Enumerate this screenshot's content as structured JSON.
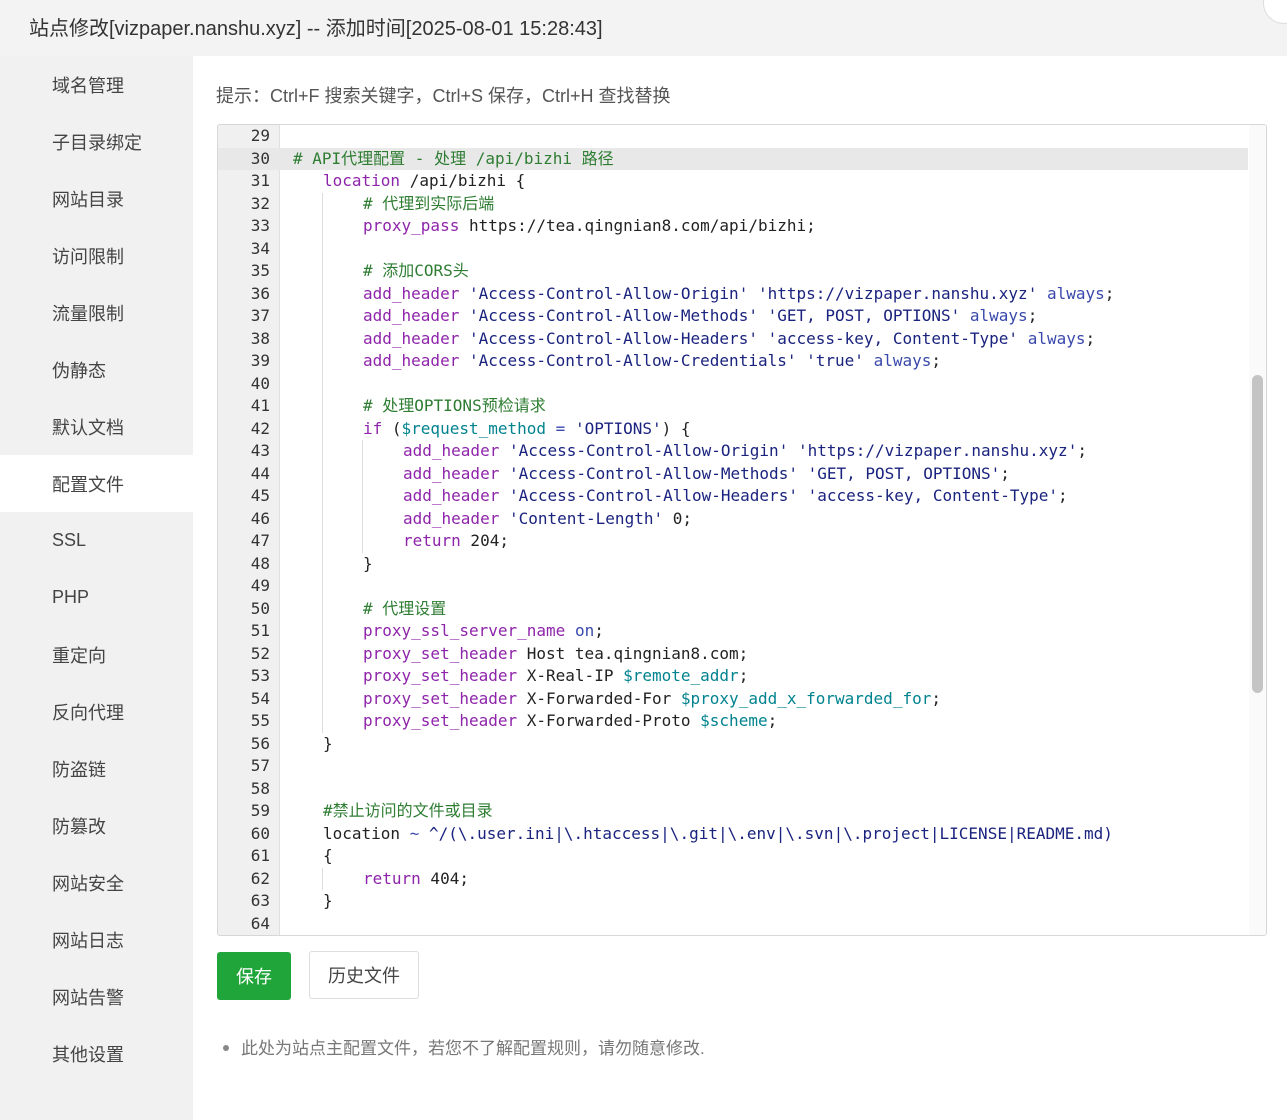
{
  "window": {
    "title": "站点修改[vizpaper.nanshu.xyz] -- 添加时间[2025-08-01 15:28:43]"
  },
  "sidebar": {
    "active_index": 7,
    "items": [
      {
        "label": "域名管理",
        "key": "domain"
      },
      {
        "label": "子目录绑定",
        "key": "subdir"
      },
      {
        "label": "网站目录",
        "key": "site-dir"
      },
      {
        "label": "访问限制",
        "key": "access-limit"
      },
      {
        "label": "流量限制",
        "key": "traffic-limit"
      },
      {
        "label": "伪静态",
        "key": "rewrite"
      },
      {
        "label": "默认文档",
        "key": "default-doc"
      },
      {
        "label": "配置文件",
        "key": "config-file"
      },
      {
        "label": "SSL",
        "key": "ssl"
      },
      {
        "label": "PHP",
        "key": "php"
      },
      {
        "label": "重定向",
        "key": "redirect"
      },
      {
        "label": "反向代理",
        "key": "reverse-proxy"
      },
      {
        "label": "防盗链",
        "key": "hotlink"
      },
      {
        "label": "防篡改",
        "key": "tamper"
      },
      {
        "label": "网站安全",
        "key": "security"
      },
      {
        "label": "网站日志",
        "key": "logs"
      },
      {
        "label": "网站告警",
        "key": "alerts"
      },
      {
        "label": "其他设置",
        "key": "other"
      }
    ]
  },
  "main": {
    "tip": "提示：Ctrl+F 搜索关键字，Ctrl+S 保存，Ctrl+H 查找替换",
    "save_label": "保存",
    "history_label": "历史文件",
    "note": "此处为站点主配置文件，若您不了解配置规则，请勿随意修改."
  },
  "editor": {
    "active_line": 30,
    "lines": [
      {
        "n": "29",
        "indent": 0,
        "tokens": []
      },
      {
        "n": "30",
        "indent": 0,
        "tokens": [
          [
            "c",
            "# API代理配置 - 处理 /api/bizhi 路径"
          ]
        ]
      },
      {
        "n": "31",
        "indent": 1,
        "tokens": [
          [
            "k",
            "location"
          ],
          [
            "p",
            " /api/bizhi {"
          ]
        ]
      },
      {
        "n": "32",
        "indent": 2,
        "tokens": [
          [
            "c",
            "# 代理到实际后端"
          ]
        ]
      },
      {
        "n": "33",
        "indent": 2,
        "tokens": [
          [
            "k",
            "proxy_pass"
          ],
          [
            "p",
            " https://tea.qingnian8.com/api/bizhi;"
          ]
        ]
      },
      {
        "n": "34",
        "indent": 2,
        "tokens": []
      },
      {
        "n": "35",
        "indent": 2,
        "tokens": [
          [
            "c",
            "# 添加CORS头"
          ]
        ]
      },
      {
        "n": "36",
        "indent": 2,
        "tokens": [
          [
            "k",
            "add_header"
          ],
          [
            "p",
            " "
          ],
          [
            "s",
            "'Access-Control-Allow-Origin'"
          ],
          [
            "p",
            " "
          ],
          [
            "s",
            "'https://vizpaper.nanshu.xyz'"
          ],
          [
            "p",
            " "
          ],
          [
            "v",
            "always"
          ],
          [
            "p",
            ";"
          ]
        ]
      },
      {
        "n": "37",
        "indent": 2,
        "tokens": [
          [
            "k",
            "add_header"
          ],
          [
            "p",
            " "
          ],
          [
            "s",
            "'Access-Control-Allow-Methods'"
          ],
          [
            "p",
            " "
          ],
          [
            "s",
            "'GET, POST, OPTIONS'"
          ],
          [
            "p",
            " "
          ],
          [
            "v",
            "always"
          ],
          [
            "p",
            ";"
          ]
        ]
      },
      {
        "n": "38",
        "indent": 2,
        "tokens": [
          [
            "k",
            "add_header"
          ],
          [
            "p",
            " "
          ],
          [
            "s",
            "'Access-Control-Allow-Headers'"
          ],
          [
            "p",
            " "
          ],
          [
            "s",
            "'access-key, Content-Type'"
          ],
          [
            "p",
            " "
          ],
          [
            "v",
            "always"
          ],
          [
            "p",
            ";"
          ]
        ]
      },
      {
        "n": "39",
        "indent": 2,
        "tokens": [
          [
            "k",
            "add_header"
          ],
          [
            "p",
            " "
          ],
          [
            "s",
            "'Access-Control-Allow-Credentials'"
          ],
          [
            "p",
            " "
          ],
          [
            "s",
            "'true'"
          ],
          [
            "p",
            " "
          ],
          [
            "v",
            "always"
          ],
          [
            "p",
            ";"
          ]
        ]
      },
      {
        "n": "40",
        "indent": 2,
        "tokens": []
      },
      {
        "n": "41",
        "indent": 2,
        "tokens": [
          [
            "c",
            "# 处理OPTIONS预检请求"
          ]
        ]
      },
      {
        "n": "42",
        "indent": 2,
        "tokens": [
          [
            "k",
            "if"
          ],
          [
            "p",
            " ("
          ],
          [
            "r",
            "$request_method"
          ],
          [
            "p",
            " "
          ],
          [
            "v",
            "="
          ],
          [
            "p",
            " "
          ],
          [
            "s",
            "'OPTIONS'"
          ],
          [
            "p",
            ") {"
          ]
        ]
      },
      {
        "n": "43",
        "indent": 3,
        "tokens": [
          [
            "k",
            "add_header"
          ],
          [
            "p",
            " "
          ],
          [
            "s",
            "'Access-Control-Allow-Origin'"
          ],
          [
            "p",
            " "
          ],
          [
            "s",
            "'https://vizpaper.nanshu.xyz'"
          ],
          [
            "p",
            ";"
          ]
        ]
      },
      {
        "n": "44",
        "indent": 3,
        "tokens": [
          [
            "k",
            "add_header"
          ],
          [
            "p",
            " "
          ],
          [
            "s",
            "'Access-Control-Allow-Methods'"
          ],
          [
            "p",
            " "
          ],
          [
            "s",
            "'GET, POST, OPTIONS'"
          ],
          [
            "p",
            ";"
          ]
        ]
      },
      {
        "n": "45",
        "indent": 3,
        "tokens": [
          [
            "k",
            "add_header"
          ],
          [
            "p",
            " "
          ],
          [
            "s",
            "'Access-Control-Allow-Headers'"
          ],
          [
            "p",
            " "
          ],
          [
            "s",
            "'access-key, Content-Type'"
          ],
          [
            "p",
            ";"
          ]
        ]
      },
      {
        "n": "46",
        "indent": 3,
        "tokens": [
          [
            "k",
            "add_header"
          ],
          [
            "p",
            " "
          ],
          [
            "s",
            "'Content-Length'"
          ],
          [
            "p",
            " 0;"
          ]
        ]
      },
      {
        "n": "47",
        "indent": 3,
        "tokens": [
          [
            "k",
            "return"
          ],
          [
            "p",
            " 204;"
          ]
        ]
      },
      {
        "n": "48",
        "indent": 2,
        "tokens": [
          [
            "p",
            "}"
          ]
        ]
      },
      {
        "n": "49",
        "indent": 2,
        "tokens": []
      },
      {
        "n": "50",
        "indent": 2,
        "tokens": [
          [
            "c",
            "# 代理设置"
          ]
        ]
      },
      {
        "n": "51",
        "indent": 2,
        "tokens": [
          [
            "k",
            "proxy_ssl_server_name"
          ],
          [
            "p",
            " "
          ],
          [
            "v",
            "on"
          ],
          [
            "p",
            ";"
          ]
        ]
      },
      {
        "n": "52",
        "indent": 2,
        "tokens": [
          [
            "k",
            "proxy_set_header"
          ],
          [
            "p",
            " Host tea.qingnian8.com;"
          ]
        ]
      },
      {
        "n": "53",
        "indent": 2,
        "tokens": [
          [
            "k",
            "proxy_set_header"
          ],
          [
            "p",
            " X-Real-IP "
          ],
          [
            "r",
            "$remote_addr"
          ],
          [
            "p",
            ";"
          ]
        ]
      },
      {
        "n": "54",
        "indent": 2,
        "tokens": [
          [
            "k",
            "proxy_set_header"
          ],
          [
            "p",
            " X-Forwarded-For "
          ],
          [
            "r",
            "$proxy_add_x_forwarded_for"
          ],
          [
            "p",
            ";"
          ]
        ]
      },
      {
        "n": "55",
        "indent": 2,
        "tokens": [
          [
            "k",
            "proxy_set_header"
          ],
          [
            "p",
            " X-Forwarded-Proto "
          ],
          [
            "r",
            "$scheme"
          ],
          [
            "p",
            ";"
          ]
        ]
      },
      {
        "n": "56",
        "indent": 1,
        "tokens": [
          [
            "p",
            "}"
          ]
        ]
      },
      {
        "n": "57",
        "indent": 0,
        "tokens": []
      },
      {
        "n": "58",
        "indent": 1,
        "tokens": []
      },
      {
        "n": "59",
        "indent": 1,
        "tokens": [
          [
            "c",
            "#禁止访问的文件或目录"
          ]
        ]
      },
      {
        "n": "60",
        "indent": 1,
        "tokens": [
          [
            "p",
            "location "
          ],
          [
            "v",
            "~"
          ],
          [
            "p",
            " "
          ],
          [
            "s",
            "^/(\\.user.ini|\\.htaccess|\\.git|\\.env|\\.svn|\\.project|LICENSE|README.md)"
          ]
        ]
      },
      {
        "n": "61",
        "indent": 1,
        "tokens": [
          [
            "p",
            "{"
          ]
        ]
      },
      {
        "n": "62",
        "indent": 2,
        "tokens": [
          [
            "k",
            "return"
          ],
          [
            "p",
            " 404;"
          ]
        ]
      },
      {
        "n": "63",
        "indent": 1,
        "tokens": [
          [
            "p",
            "}"
          ]
        ]
      },
      {
        "n": "64",
        "indent": 0,
        "tokens": []
      }
    ]
  }
}
